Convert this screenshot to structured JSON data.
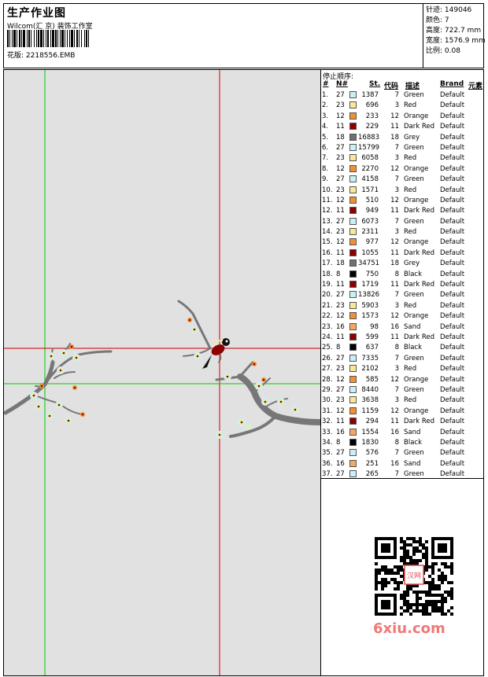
{
  "header": {
    "title": "生产作业图",
    "studio": "Wilcom(汇 京) 装饰工作室",
    "filename": "花版: 2218556.EMB"
  },
  "stats": [
    {
      "label": "针迹:",
      "value": "149046"
    },
    {
      "label": "颜色:",
      "value": "7"
    },
    {
      "label": "高度:",
      "value": "722.7 mm"
    },
    {
      "label": "宽度:",
      "value": "1576.9 mm"
    },
    {
      "label": "比例:",
      "value": "0.08"
    }
  ],
  "stop_sequence": {
    "title": "停止顺序:",
    "columns": [
      "#",
      "N#",
      "St.",
      "代码",
      "描述",
      "Brand",
      "元素"
    ],
    "rows": [
      {
        "idx": "1.",
        "n": "27",
        "st": "1387",
        "code": "7",
        "desc": "Green",
        "brand": "Default"
      },
      {
        "idx": "2.",
        "n": "23",
        "st": "696",
        "code": "3",
        "desc": "Red",
        "brand": "Default"
      },
      {
        "idx": "3.",
        "n": "12",
        "st": "233",
        "code": "12",
        "desc": "Orange",
        "brand": "Default"
      },
      {
        "idx": "4.",
        "n": "11",
        "st": "229",
        "code": "11",
        "desc": "Dark Red",
        "brand": "Default"
      },
      {
        "idx": "5.",
        "n": "18",
        "st": "16883",
        "code": "18",
        "desc": "Grey",
        "brand": "Default"
      },
      {
        "idx": "6.",
        "n": "27",
        "st": "15799",
        "code": "7",
        "desc": "Green",
        "brand": "Default"
      },
      {
        "idx": "7.",
        "n": "23",
        "st": "6058",
        "code": "3",
        "desc": "Red",
        "brand": "Default"
      },
      {
        "idx": "8.",
        "n": "12",
        "st": "2270",
        "code": "12",
        "desc": "Orange",
        "brand": "Default"
      },
      {
        "idx": "9.",
        "n": "27",
        "st": "4158",
        "code": "7",
        "desc": "Green",
        "brand": "Default"
      },
      {
        "idx": "10.",
        "n": "23",
        "st": "1571",
        "code": "3",
        "desc": "Red",
        "brand": "Default"
      },
      {
        "idx": "11.",
        "n": "12",
        "st": "510",
        "code": "12",
        "desc": "Orange",
        "brand": "Default"
      },
      {
        "idx": "12.",
        "n": "11",
        "st": "949",
        "code": "11",
        "desc": "Dark Red",
        "brand": "Default"
      },
      {
        "idx": "13.",
        "n": "27",
        "st": "6073",
        "code": "7",
        "desc": "Green",
        "brand": "Default"
      },
      {
        "idx": "14.",
        "n": "23",
        "st": "2311",
        "code": "3",
        "desc": "Red",
        "brand": "Default"
      },
      {
        "idx": "15.",
        "n": "12",
        "st": "977",
        "code": "12",
        "desc": "Orange",
        "brand": "Default"
      },
      {
        "idx": "16.",
        "n": "11",
        "st": "1055",
        "code": "11",
        "desc": "Dark Red",
        "brand": "Default"
      },
      {
        "idx": "17.",
        "n": "18",
        "st": "34751",
        "code": "18",
        "desc": "Grey",
        "brand": "Default"
      },
      {
        "idx": "18.",
        "n": "8",
        "st": "750",
        "code": "8",
        "desc": "Black",
        "brand": "Default"
      },
      {
        "idx": "19.",
        "n": "11",
        "st": "1719",
        "code": "11",
        "desc": "Dark Red",
        "brand": "Default"
      },
      {
        "idx": "20.",
        "n": "27",
        "st": "13826",
        "code": "7",
        "desc": "Green",
        "brand": "Default"
      },
      {
        "idx": "21.",
        "n": "23",
        "st": "5903",
        "code": "3",
        "desc": "Red",
        "brand": "Default"
      },
      {
        "idx": "22.",
        "n": "12",
        "st": "1573",
        "code": "12",
        "desc": "Orange",
        "brand": "Default"
      },
      {
        "idx": "23.",
        "n": "16",
        "st": "98",
        "code": "16",
        "desc": "Sand",
        "brand": "Default"
      },
      {
        "idx": "24.",
        "n": "11",
        "st": "599",
        "code": "11",
        "desc": "Dark Red",
        "brand": "Default"
      },
      {
        "idx": "25.",
        "n": "8",
        "st": "637",
        "code": "8",
        "desc": "Black",
        "brand": "Default"
      },
      {
        "idx": "26.",
        "n": "27",
        "st": "7335",
        "code": "7",
        "desc": "Green",
        "brand": "Default"
      },
      {
        "idx": "27.",
        "n": "23",
        "st": "2102",
        "code": "3",
        "desc": "Red",
        "brand": "Default"
      },
      {
        "idx": "28.",
        "n": "12",
        "st": "585",
        "code": "12",
        "desc": "Orange",
        "brand": "Default"
      },
      {
        "idx": "29.",
        "n": "27",
        "st": "8440",
        "code": "7",
        "desc": "Green",
        "brand": "Default"
      },
      {
        "idx": "30.",
        "n": "23",
        "st": "3638",
        "code": "3",
        "desc": "Red",
        "brand": "Default"
      },
      {
        "idx": "31.",
        "n": "12",
        "st": "1159",
        "code": "12",
        "desc": "Orange",
        "brand": "Default"
      },
      {
        "idx": "32.",
        "n": "11",
        "st": "294",
        "code": "11",
        "desc": "Dark Red",
        "brand": "Default"
      },
      {
        "idx": "33.",
        "n": "16",
        "st": "1554",
        "code": "16",
        "desc": "Sand",
        "brand": "Default"
      },
      {
        "idx": "34.",
        "n": "8",
        "st": "1830",
        "code": "8",
        "desc": "Black",
        "brand": "Default"
      },
      {
        "idx": "35.",
        "n": "27",
        "st": "576",
        "code": "7",
        "desc": "Green",
        "brand": "Default"
      },
      {
        "idx": "36.",
        "n": "16",
        "st": "251",
        "code": "16",
        "desc": "Sand",
        "brand": "Default"
      },
      {
        "idx": "37.",
        "n": "27",
        "st": "265",
        "code": "7",
        "desc": "Green",
        "brand": "Default"
      }
    ]
  },
  "swatch_colors": {
    "Green": "#c8f0f5",
    "Red": "#f8e898",
    "Orange": "#f09030",
    "Dark Red": "#8b0000",
    "Grey": "#707070",
    "Black": "#000000",
    "Sand": "#f4a860"
  },
  "qr_badge": "汉网",
  "watermark": "6xiu.com"
}
